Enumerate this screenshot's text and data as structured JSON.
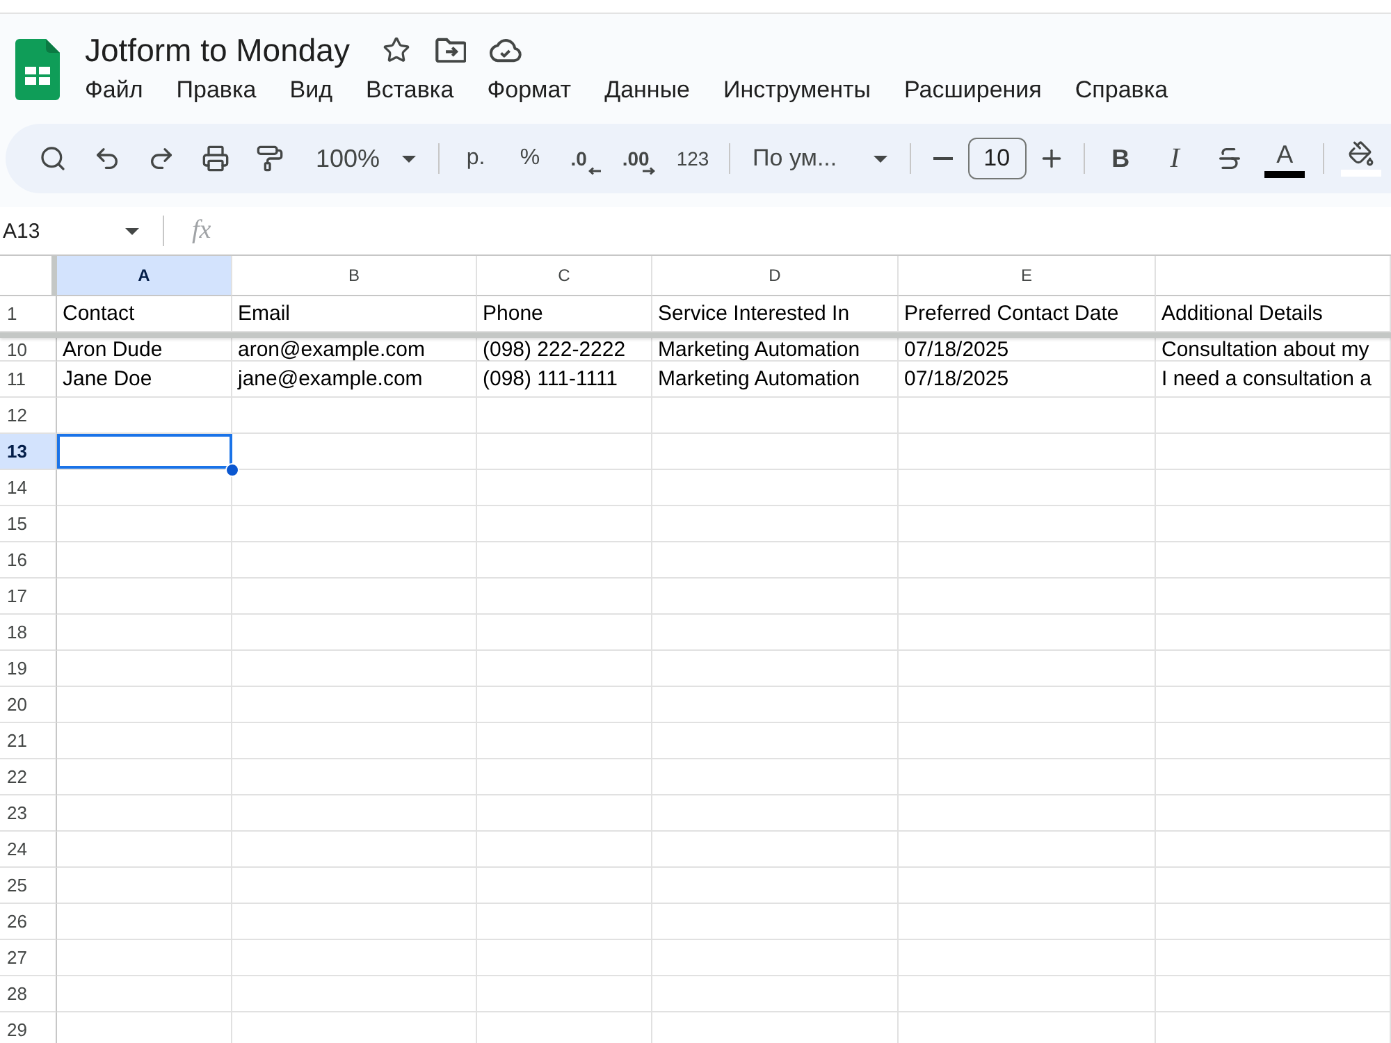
{
  "document": {
    "title": "Jotform to Monday"
  },
  "menu": [
    "Файл",
    "Правка",
    "Вид",
    "Вставка",
    "Формат",
    "Данные",
    "Инструменты",
    "Расширения",
    "Справка"
  ],
  "toolbar": {
    "zoom": "100%",
    "currency": "р.",
    "percent": "%",
    "decrease_decimals": ".0",
    "increase_decimals": ".00",
    "number_format": "123",
    "font": "По ум...",
    "font_size": "10",
    "bold": "B",
    "italic": "I",
    "text_color": {
      "label": "A",
      "color": "#000000"
    },
    "fill_color": {
      "color": "#ffffff"
    }
  },
  "formula_bar": {
    "name_box": "A13",
    "formula_label": "fx"
  },
  "grid": {
    "columns": [
      {
        "label": "A",
        "selected": true
      },
      {
        "label": "B",
        "selected": false
      },
      {
        "label": "C",
        "selected": false
      },
      {
        "label": "D",
        "selected": false
      },
      {
        "label": "E",
        "selected": false
      },
      {
        "selected": false
      }
    ],
    "frozen_rows": [
      {
        "number": "1",
        "kind": "full",
        "selected": false,
        "cells": [
          "Contact",
          "Email",
          "Phone",
          "Service Interested In",
          "Preferred Contact Date",
          "Additional Details"
        ]
      }
    ],
    "rows": [
      {
        "number": "10",
        "kind": "partial",
        "selected": false,
        "cells": [
          "Aron Dude",
          "aron@example.com",
          "(098) 222-2222",
          "Marketing Automation",
          "07/18/2025",
          "Consultation about my"
        ]
      },
      {
        "number": "11",
        "kind": "full",
        "selected": false,
        "cells": [
          "Jane Doe",
          "jane@example.com",
          "(098) 111-1111",
          "Marketing Automation",
          "07/18/2025",
          "I need a consultation a"
        ]
      },
      {
        "number": "12",
        "kind": "full",
        "selected": false
      },
      {
        "number": "13",
        "kind": "full",
        "selected": true
      },
      {
        "number": "14",
        "kind": "full",
        "selected": false
      },
      {
        "number": "15",
        "kind": "full",
        "selected": false
      },
      {
        "number": "16",
        "kind": "full",
        "selected": false
      },
      {
        "number": "17",
        "kind": "full",
        "selected": false
      },
      {
        "number": "18",
        "kind": "full",
        "selected": false
      },
      {
        "number": "19",
        "kind": "full",
        "selected": false
      },
      {
        "number": "20",
        "kind": "full",
        "selected": false
      },
      {
        "number": "21",
        "kind": "full",
        "selected": false
      },
      {
        "number": "22",
        "kind": "full",
        "selected": false
      },
      {
        "number": "23",
        "kind": "full",
        "selected": false
      },
      {
        "number": "24",
        "kind": "full",
        "selected": false
      },
      {
        "number": "25",
        "kind": "full",
        "selected": false
      },
      {
        "number": "26",
        "kind": "full",
        "selected": false
      },
      {
        "number": "27",
        "kind": "full",
        "selected": false
      },
      {
        "number": "28",
        "kind": "full",
        "selected": false
      },
      {
        "number": "29",
        "kind": "full",
        "selected": false
      }
    ]
  }
}
